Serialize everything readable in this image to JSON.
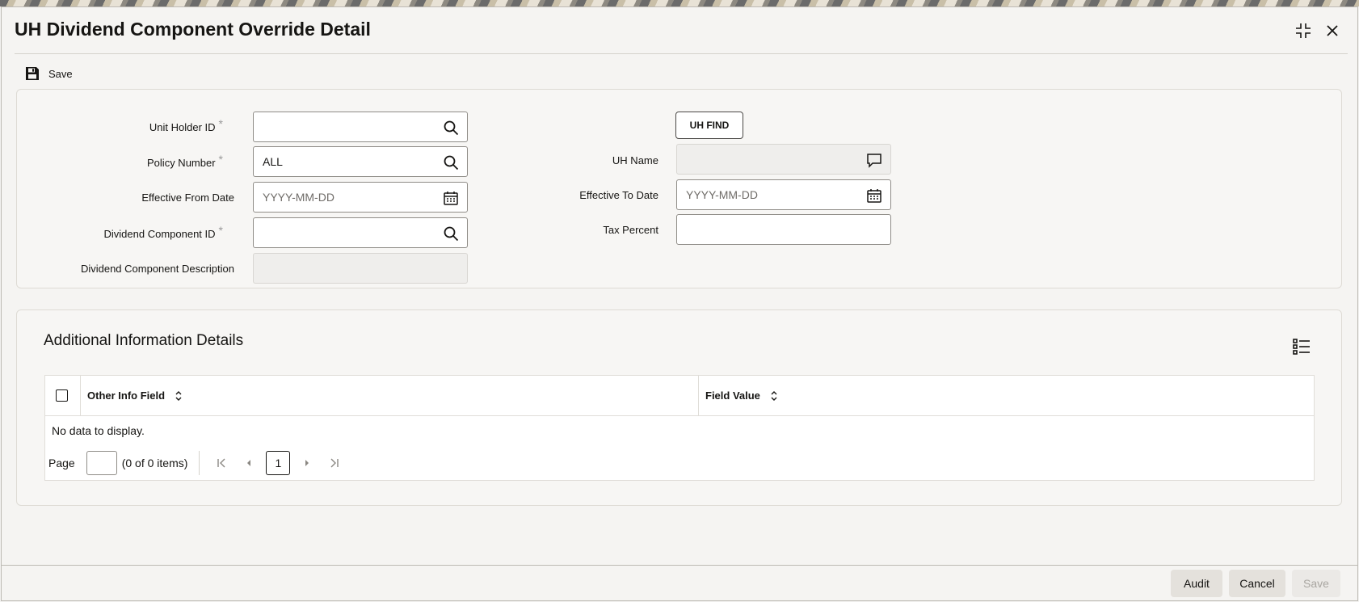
{
  "window": {
    "title": "UH Dividend Component Override Detail"
  },
  "toolbar": {
    "save_label": "Save"
  },
  "form": {
    "unit_holder_id": {
      "label": "Unit Holder ID",
      "value": "",
      "required_mark": "*"
    },
    "policy_number": {
      "label": "Policy Number",
      "value": "ALL",
      "required_mark": "*"
    },
    "effective_from_date": {
      "label": "Effective From Date",
      "value": "",
      "placeholder": "YYYY-MM-DD"
    },
    "dividend_component_id": {
      "label": "Dividend Component ID",
      "value": "",
      "required_mark": "*"
    },
    "dividend_component_description": {
      "label": "Dividend Component Description",
      "value": ""
    },
    "uh_find_label": "UH FIND",
    "uh_name": {
      "label": "UH Name",
      "value": ""
    },
    "effective_to_date": {
      "label": "Effective To Date",
      "value": "",
      "placeholder": "YYYY-MM-DD"
    },
    "tax_percent": {
      "label": "Tax Percent",
      "value": ""
    }
  },
  "additional_info": {
    "title": "Additional Information Details",
    "columns": [
      "Other Info Field",
      "Field Value"
    ],
    "rows": [],
    "empty_text": "No data to display.",
    "pager": {
      "page_label": "Page",
      "page_value": "",
      "count_text": "(0 of 0 items)",
      "current_page": "1"
    }
  },
  "footer": {
    "audit_label": "Audit",
    "cancel_label": "Cancel",
    "save_label": "Save"
  },
  "icons": {
    "expand": "collapse-fullscreen-icon",
    "close": "close-icon",
    "save": "floppy-disk-icon",
    "search": "search-icon",
    "calendar": "calendar-icon",
    "comment": "speech-bubble-icon",
    "list": "list-view-icon",
    "sort": "sort-icon"
  },
  "colors": {
    "text": "#161513",
    "panel_bg": "#f7f6f4",
    "border": "#8f8c87",
    "readonly_bg": "#efeeec"
  }
}
